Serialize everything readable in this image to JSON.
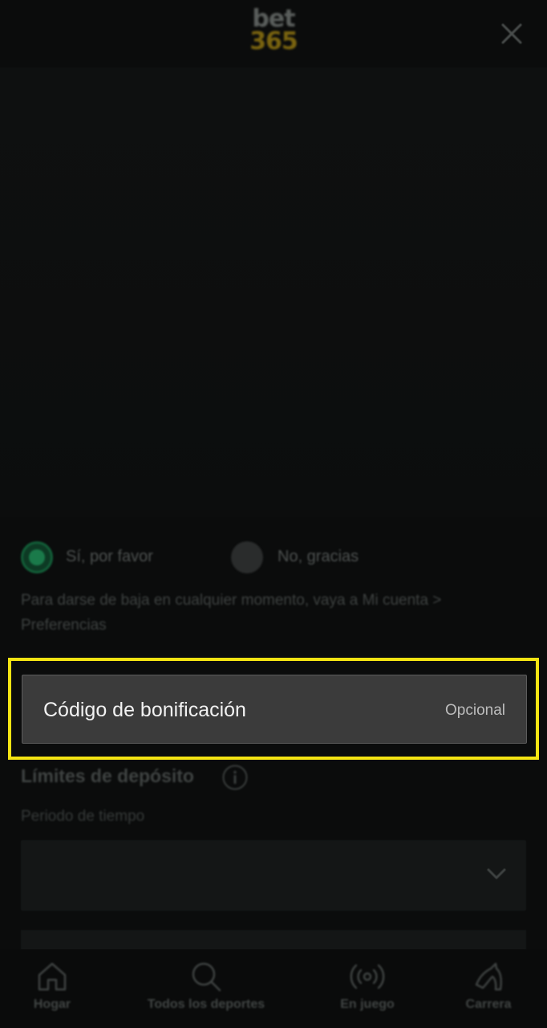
{
  "header": {
    "logo_top": "bet",
    "logo_bottom": "365",
    "close_icon": "close-icon"
  },
  "marketing": {
    "options": [
      {
        "label": "Sí, por favor",
        "selected": true
      },
      {
        "label": "No, gracias",
        "selected": false
      }
    ],
    "unsubscribe_note": "Para darse de baja en cualquier momento, vaya a Mi cuenta > Preferencias"
  },
  "bonus_code": {
    "label": "Código de bonificación",
    "optional_text": "Opcional",
    "highlight_color": "#f4e413"
  },
  "deposit_limits": {
    "title": "Límites de depósito",
    "period_label": "Periodo de tiempo",
    "period_value": ""
  },
  "bottom_nav": {
    "items": [
      {
        "label": "Hogar",
        "icon": "home-icon"
      },
      {
        "label": "Todos los deportes",
        "icon": "search-icon"
      },
      {
        "label": "En juego",
        "icon": "live-broadcast-icon"
      },
      {
        "label": "Carrera",
        "icon": "horse-icon"
      }
    ]
  },
  "colors": {
    "background": "#0b0c0c",
    "accent_green": "#1a7a4a",
    "field_background": "#3b3b3b"
  }
}
